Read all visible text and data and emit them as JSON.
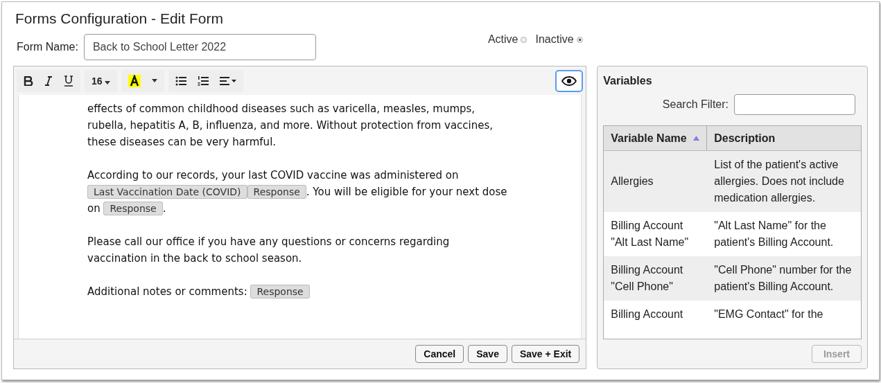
{
  "title": "Forms Configuration - Edit Form",
  "form_name": {
    "label": "Form Name:",
    "value": "Back to School Letter 2022"
  },
  "status_options": [
    {
      "label": "Active",
      "selected": false
    },
    {
      "label": "Inactive",
      "selected": true
    }
  ],
  "toolbar": {
    "font_size": "16",
    "preview_selected": true
  },
  "paragraphs": [
    [
      {
        "kind": "text",
        "text": "effects of common childhood diseases such as varicella, measles, mumps, rubella, hepatitis A, B, influenza, and more. Without protection from vaccines, these diseases can be very harmful."
      }
    ],
    [
      {
        "kind": "text",
        "text": "According to our records, your last COVID vaccine was administered on "
      },
      {
        "kind": "chip",
        "text": "Last Vaccination Date (COVID)"
      },
      {
        "kind": "chip",
        "text": "Response"
      },
      {
        "kind": "text",
        "text": ". You will be eligible for your next dose on "
      },
      {
        "kind": "chip",
        "text": "Response"
      },
      {
        "kind": "text",
        "text": "."
      }
    ],
    [
      {
        "kind": "text",
        "text": "Please call our office if you have any questions or concerns regarding vaccination in the back to school season."
      }
    ],
    [
      {
        "kind": "text",
        "text": "Additional notes or comments: "
      },
      {
        "kind": "chip",
        "text": "Response"
      }
    ]
  ],
  "editor_buttons": [
    "Cancel",
    "Save",
    "Save + Exit"
  ],
  "variables": {
    "title": "Variables",
    "filter_label": "Search Filter:",
    "columns": [
      "Variable Name",
      "Description"
    ],
    "rows": [
      {
        "name": "Allergies",
        "description": "List of the patient's active allergies. Does not include medication allergies."
      },
      {
        "name": "Billing Account \"Alt Last Name\"",
        "description": "\"Alt Last Name\" for the patient's Billing Account."
      },
      {
        "name": "Billing Account \"Cell Phone\"",
        "description": "\"Cell Phone\" number for the patient's Billing Account."
      },
      {
        "name": "Billing Account",
        "description": "\"EMG Contact\" for the"
      }
    ],
    "insert": {
      "label": "Insert",
      "disabled": true
    }
  }
}
